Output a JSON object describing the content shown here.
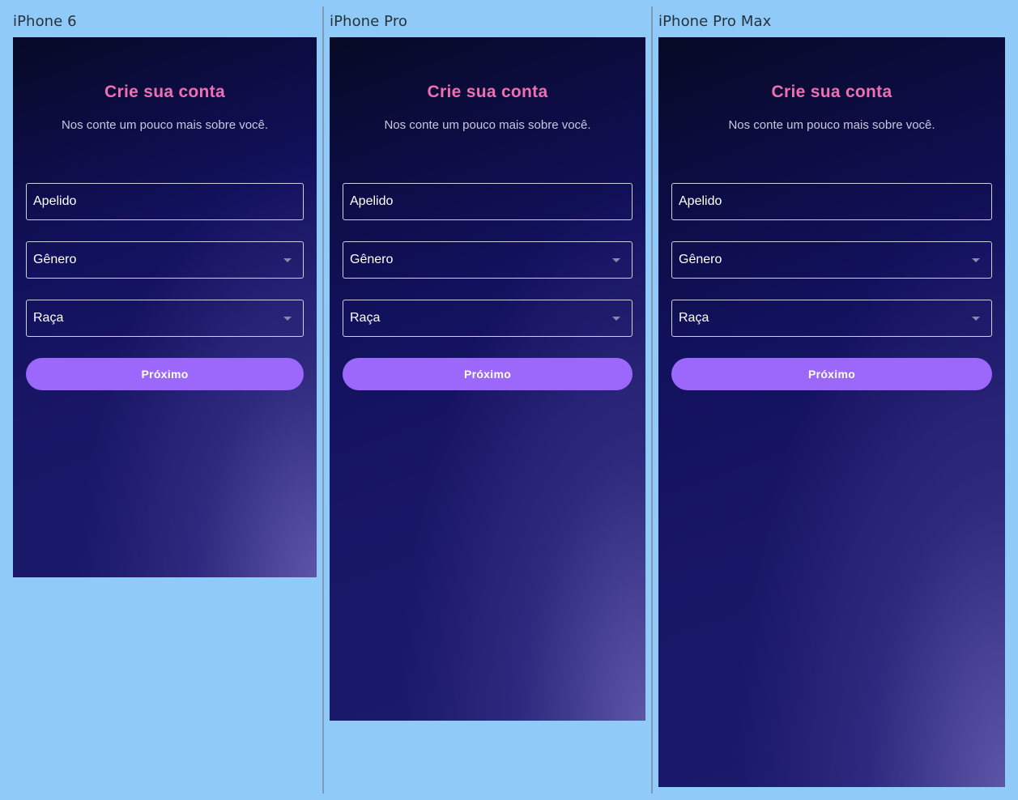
{
  "screens": [
    {
      "label": "iPhone 6",
      "title": "Crie sua conta",
      "subtitle": "Nos conte um pouco mais sobre você.",
      "nickname_field": "Apelido",
      "gender_field": "Gênero",
      "race_field": "Raça",
      "next_button": "Próximo"
    },
    {
      "label": "iPhone Pro",
      "title": "Crie sua conta",
      "subtitle": "Nos conte um pouco mais sobre você.",
      "nickname_field": "Apelido",
      "gender_field": "Gênero",
      "race_field": "Raça",
      "next_button": "Próximo"
    },
    {
      "label": "iPhone Pro Max",
      "title": "Crie sua conta",
      "subtitle": "Nos conte um pouco mais sobre você.",
      "nickname_field": "Apelido",
      "gender_field": "Gênero",
      "race_field": "Raça",
      "next_button": "Próximo"
    }
  ],
  "colors": {
    "background": "#90caf9",
    "title": "#f06fb0",
    "button": "#9c67fb",
    "screen_dark": "#0c0c42"
  },
  "icons": {
    "dropdown": "caret-down-icon"
  }
}
